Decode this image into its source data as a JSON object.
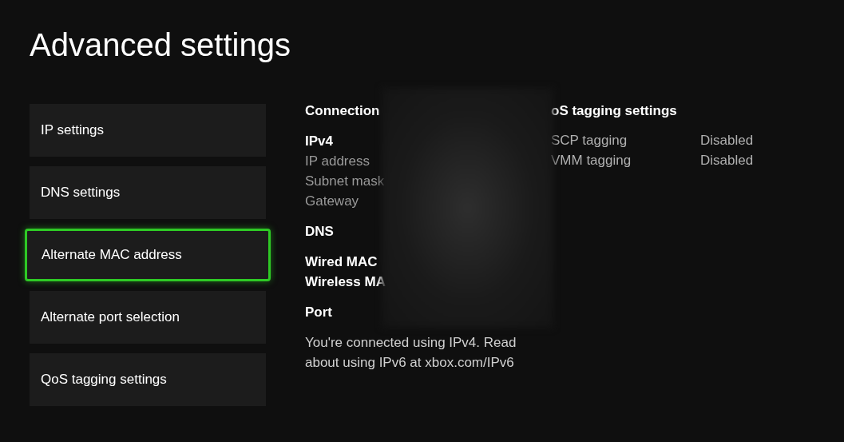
{
  "title": "Advanced settings",
  "menu": [
    {
      "label": "IP settings",
      "selected": false
    },
    {
      "label": "DNS settings",
      "selected": false
    },
    {
      "label": "Alternate MAC address",
      "selected": true
    },
    {
      "label": "Alternate port selection",
      "selected": false
    },
    {
      "label": "QoS tagging settings",
      "selected": false
    }
  ],
  "details": [
    [
      {
        "kind": "heading",
        "text": "Connection"
      }
    ],
    [
      {
        "kind": "heading",
        "text": "IPv4"
      },
      {
        "kind": "item",
        "text": "IP address"
      },
      {
        "kind": "item",
        "text": "Subnet mask"
      },
      {
        "kind": "item",
        "text": "Gateway"
      }
    ],
    [
      {
        "kind": "heading",
        "text": "DNS"
      }
    ],
    [
      {
        "kind": "heading",
        "text": "Wired MAC"
      },
      {
        "kind": "heading",
        "text": "Wireless MA"
      }
    ],
    [
      {
        "kind": "heading",
        "text": "Port"
      }
    ],
    [
      {
        "kind": "note",
        "text": "You're connected using IPv4. Read about using IPv6 at xbox.com/IPv6"
      }
    ]
  ],
  "qos": {
    "heading": "oS tagging settings",
    "rows": [
      {
        "label": "SCP tagging",
        "value": "Disabled"
      },
      {
        "label": "VMM tagging",
        "value": "Disabled"
      }
    ]
  }
}
